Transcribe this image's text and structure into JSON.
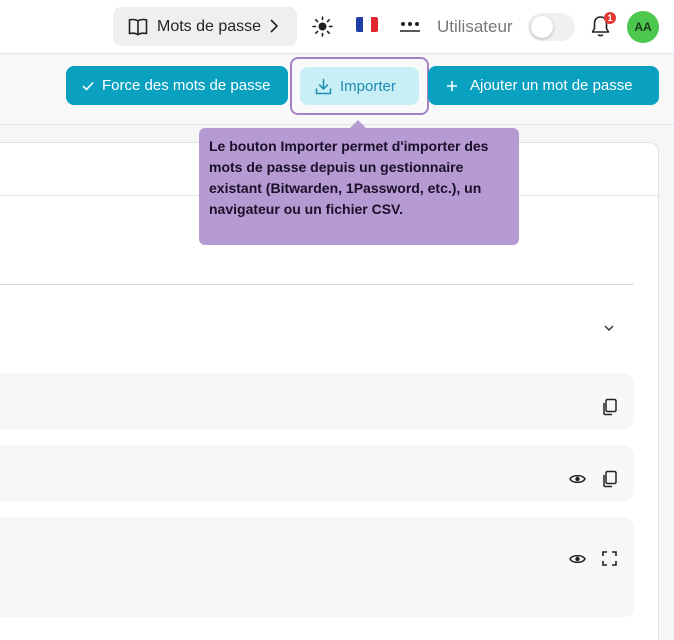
{
  "header": {
    "breadcrumb_label": "Mots de passe",
    "user_label": "Utilisateur",
    "notification_count": "1",
    "avatar_initials": "AA",
    "icons": [
      "book-icon",
      "chevron-right-icon",
      "sun-icon",
      "flag-fr-icon",
      "password-dots-icon",
      "bell-icon"
    ]
  },
  "toolbar": {
    "strength_label": "Force des mots de passe",
    "import_label": "Importer",
    "add_label": "Ajouter un mot de passe"
  },
  "tooltip": {
    "text": "Le bouton Importer permet d'importer des mots de passe depuis un gestionnaire existant (Bitwarden, 1Password, etc.), un navigateur ou un fichier CSV."
  },
  "colors": {
    "primary": "#0aa0c0",
    "import_bg": "#c8eef6",
    "highlight": "#a682c5",
    "tooltip_bg": "#b59bd1",
    "avatar_bg": "#4cc84f",
    "badge": "#e53935"
  }
}
